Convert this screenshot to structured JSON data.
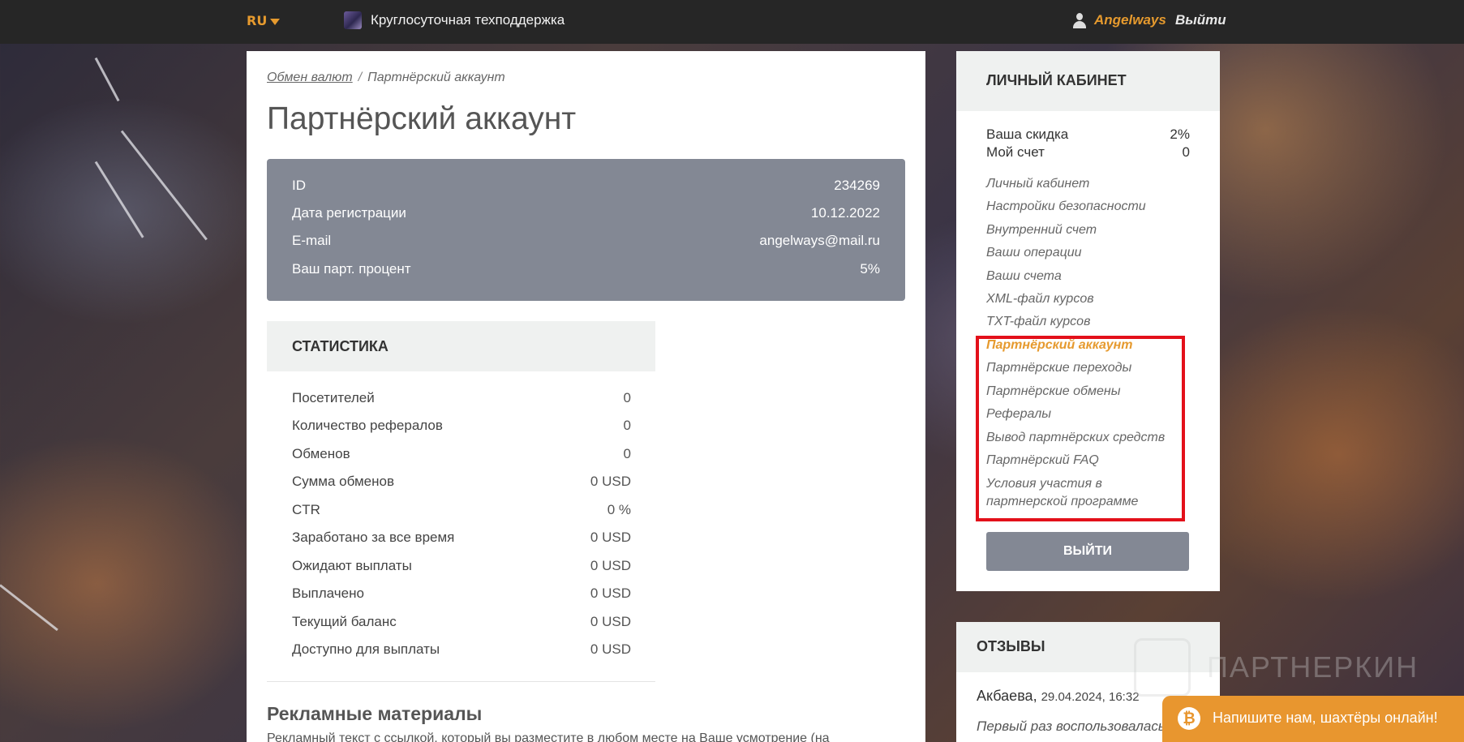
{
  "topbar": {
    "lang": "RU",
    "support_text": "Круглосуточная техподдержка",
    "username": "Angelways",
    "logout": "Выйти"
  },
  "breadcrumb": {
    "home": "Обмен валют",
    "separator": "/",
    "current": "Партнёрский аккаунт"
  },
  "page_title": "Партнёрский аккаунт",
  "account_info": [
    {
      "label": "ID",
      "value": "234269"
    },
    {
      "label": "Дата регистрации",
      "value": "10.12.2022"
    },
    {
      "label": "E-mail",
      "value": "angelways@mail.ru"
    },
    {
      "label": "Ваш парт. процент",
      "value": "5%"
    }
  ],
  "stats": {
    "title": "СТАТИСТИКА",
    "rows": [
      {
        "label": "Посетителей",
        "value": "0"
      },
      {
        "label": "Количество рефералов",
        "value": "0"
      },
      {
        "label": "Обменов",
        "value": "0"
      },
      {
        "label": "Сумма обменов",
        "value": "0 USD"
      },
      {
        "label": "CTR",
        "value": "0 %"
      },
      {
        "label": "Заработано за все время",
        "value": "0 USD"
      },
      {
        "label": "Ожидают выплаты",
        "value": "0 USD"
      },
      {
        "label": "Выплачено",
        "value": "0 USD"
      },
      {
        "label": "Текущий баланс",
        "value": "0 USD"
      },
      {
        "label": "Доступно для выплаты",
        "value": "0 USD"
      }
    ]
  },
  "promo": {
    "title": "Рекламные материалы",
    "text": "Рекламный текст с ссылкой, который вы разместите в любом месте на Ваше усмотрение (на"
  },
  "sidebar": {
    "title": "ЛИЧНЫЙ КАБИНЕТ",
    "discount_label": "Ваша скидка",
    "discount_value": "2%",
    "account_label": "Мой счет",
    "account_value": "0",
    "links": [
      "Личный кабинет",
      "Настройки безопасности",
      "Внутренний счет",
      "Ваши операции",
      "Ваши счета",
      "XML-файл курсов",
      "TXT-файл курсов",
      "Партнёрский аккаунт",
      "Партнёрские переходы",
      "Партнёрские обмены",
      "Рефералы",
      "Вывод партнёрских средств",
      "Партнёрский FAQ",
      "Условия участия в",
      "партнерской программе"
    ],
    "logout_button": "ВЫЙТИ"
  },
  "reviews": {
    "title": "ОТЗЫВЫ",
    "author": "Акбаева,",
    "date": "29.04.2024, 16:32",
    "text": "Первый раз воспользовалась сервисом. Всё быстро"
  },
  "watermark": "ПАРТНЕРКИН",
  "chat": {
    "icon": "bitcoin-icon",
    "text": "Напишите нам, шахтёры онлайн!"
  },
  "colors": {
    "accent": "#e69a2e",
    "panel_gray": "#838894",
    "highlight": "#e3101a",
    "topbar": "#262626"
  }
}
